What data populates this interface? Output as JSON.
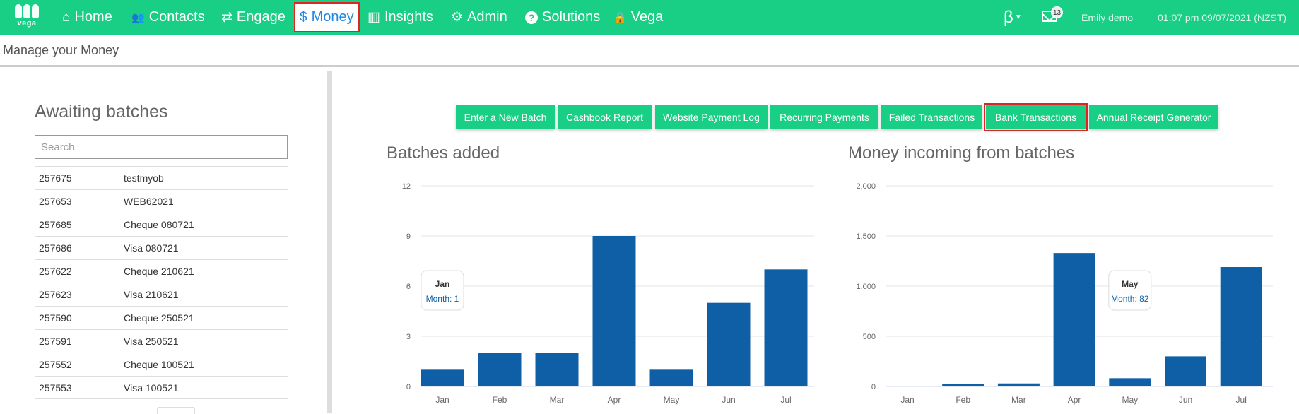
{
  "nav": {
    "logo_text": "vega",
    "items": [
      {
        "label": "Home",
        "icon": "home-icon",
        "glyph": "⌂"
      },
      {
        "label": "Contacts",
        "icon": "users-icon",
        "glyph": "👥"
      },
      {
        "label": "Engage",
        "icon": "exchange-icon",
        "glyph": "⇄"
      },
      {
        "label": "Money",
        "icon": "dollar-icon",
        "glyph": "$"
      },
      {
        "label": "Insights",
        "icon": "bar-chart-icon",
        "glyph": "▥"
      },
      {
        "label": "Admin",
        "icon": "cogs-icon",
        "glyph": "⚙"
      },
      {
        "label": "Solutions",
        "icon": "question-icon",
        "glyph": "?"
      },
      {
        "label": "Vega",
        "icon": "lock-icon",
        "glyph": "🔒"
      }
    ],
    "beta": "β",
    "mail_badge": "13",
    "user": "Emily demo",
    "datetime": "01:07 pm 09/07/2021 (NZST)"
  },
  "subheader": "Manage your Money",
  "left": {
    "title": "Awaiting batches",
    "search_placeholder": "Search",
    "batches": [
      {
        "id": "257675",
        "name": "testmyob"
      },
      {
        "id": "257653",
        "name": "WEB62021"
      },
      {
        "id": "257685",
        "name": "Cheque 080721"
      },
      {
        "id": "257686",
        "name": "Visa 080721"
      },
      {
        "id": "257622",
        "name": "Cheque 210621"
      },
      {
        "id": "257623",
        "name": "Visa 210621"
      },
      {
        "id": "257590",
        "name": "Cheque 250521"
      },
      {
        "id": "257591",
        "name": "Visa 250521"
      },
      {
        "id": "257552",
        "name": "Cheque 100521"
      },
      {
        "id": "257553",
        "name": "Visa 100521"
      }
    ]
  },
  "buttons": [
    "Enter a New Batch",
    "Cashbook Report",
    "Website Payment Log",
    "Recurring Payments",
    "Failed Transactions",
    "Bank Transactions",
    "Annual Receipt Generator"
  ],
  "colors": {
    "brand": "#19cf86",
    "bar": "#0e5fa6",
    "highlight": "#e02424",
    "active_link": "#1e88e5"
  },
  "chart_data": [
    {
      "type": "bar",
      "title": "Batches added",
      "categories": [
        "Jan",
        "Feb",
        "Mar",
        "Apr",
        "May",
        "Jun",
        "Jul"
      ],
      "values": [
        1,
        2,
        2,
        9,
        1,
        5,
        7
      ],
      "ylim": [
        0,
        12
      ],
      "yticks": [
        "0",
        "3",
        "6",
        "9",
        "12"
      ],
      "tooltip": {
        "category": "Jan",
        "label": "Month: 1"
      }
    },
    {
      "type": "bar",
      "title": "Money incoming from batches",
      "categories": [
        "Jan",
        "Feb",
        "Mar",
        "Apr",
        "May",
        "Jun",
        "Jul"
      ],
      "values": [
        5,
        28,
        30,
        1330,
        82,
        300,
        1190
      ],
      "ylim": [
        0,
        2000
      ],
      "yticks": [
        "0",
        "500",
        "1,000",
        "1,500",
        "2,000"
      ],
      "tooltip": {
        "category": "May",
        "label": "Month: 82"
      }
    }
  ]
}
